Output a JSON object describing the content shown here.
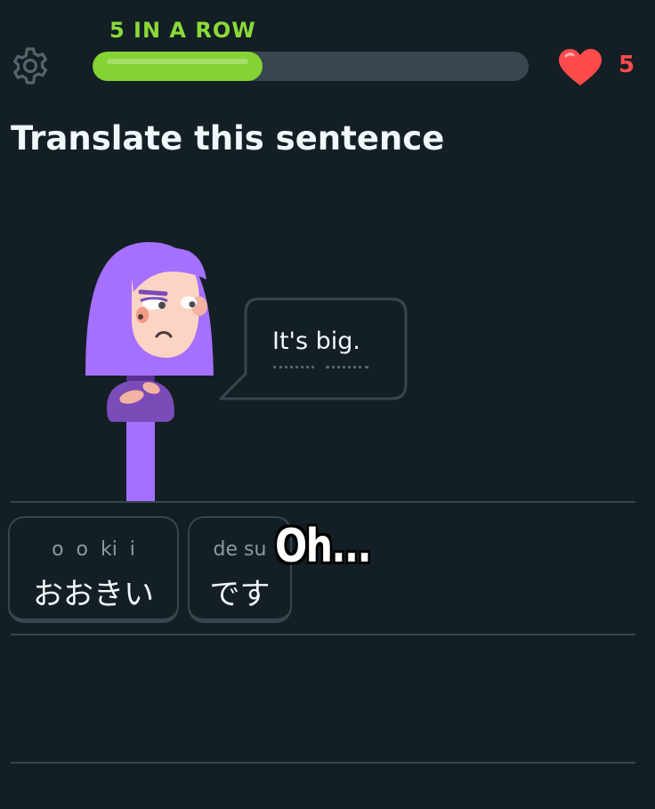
{
  "header": {
    "streak_label": "5 IN A ROW",
    "progress_fraction": 0.39,
    "hearts_count": "5",
    "settings_icon": "gear-icon",
    "hearts_icon": "heart-icon"
  },
  "challenge": {
    "title": "Translate this sentence",
    "prompt_sentence": "It's big."
  },
  "word_bank": [
    {
      "reading": "o  o  ki  i",
      "word": "おおきい"
    },
    {
      "reading": "de su",
      "word": "です"
    }
  ],
  "overlay": {
    "caption": "Oh..."
  },
  "colors": {
    "background": "#131f24",
    "streak_green": "#8cd93a",
    "progress_fill": "#84d233",
    "progress_track": "#37464f",
    "heart_red": "#ff4b4b",
    "character_hair": "#a570ff"
  }
}
